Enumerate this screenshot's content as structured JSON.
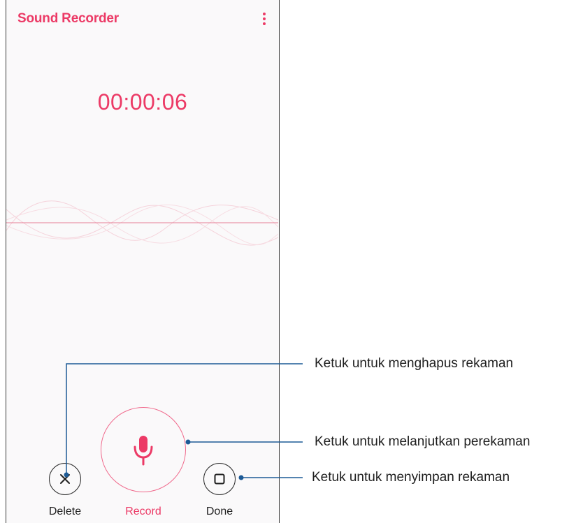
{
  "app": {
    "title": "Sound Recorder"
  },
  "timer": "00:00:06",
  "controls": {
    "delete_label": "Delete",
    "record_label": "Record",
    "done_label": "Done"
  },
  "callouts": {
    "delete": "Ketuk untuk menghapus rekaman",
    "record": "Ketuk untuk melanjutkan perekaman",
    "done": "Ketuk untuk menyimpan rekaman"
  },
  "colors": {
    "accent": "#ec3a66",
    "accent_light": "#f06b8d",
    "callout_line": "#1c5a96",
    "wave": "#f2c4cf"
  },
  "icons": {
    "menu": "more-vert-icon",
    "delete": "close-icon",
    "record": "microphone-icon",
    "done": "stop-icon"
  }
}
